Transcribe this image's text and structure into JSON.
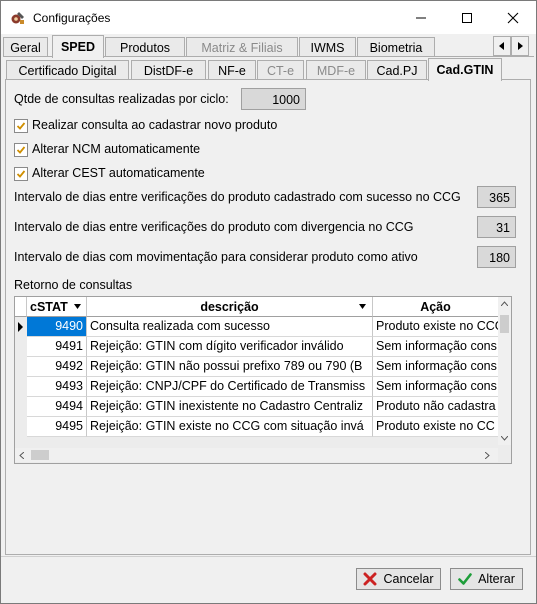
{
  "window": {
    "title": "Configurações"
  },
  "tabs_main": [
    {
      "label": "Geral",
      "state": "normal"
    },
    {
      "label": "SPED",
      "state": "active"
    },
    {
      "label": "Produtos",
      "state": "normal"
    },
    {
      "label": "Matriz & Filiais",
      "state": "disabled"
    },
    {
      "label": "IWMS",
      "state": "normal"
    },
    {
      "label": "Biometria",
      "state": "normal"
    }
  ],
  "tabs_sub": [
    {
      "label": "Certificado Digital",
      "state": "normal"
    },
    {
      "label": "DistDF-e",
      "state": "normal"
    },
    {
      "label": "NF-e",
      "state": "normal"
    },
    {
      "label": "CT-e",
      "state": "disabled"
    },
    {
      "label": "MDF-e",
      "state": "disabled"
    },
    {
      "label": "Cad.PJ",
      "state": "normal"
    },
    {
      "label": "Cad.GTIN",
      "state": "active"
    }
  ],
  "form": {
    "qtde_label": "Qtde de consultas realizadas por ciclo:",
    "qtde_value": "1000",
    "checkboxes": [
      {
        "label": "Realizar consulta ao cadastrar novo produto",
        "checked": true
      },
      {
        "label": "Alterar NCM automaticamente",
        "checked": true
      },
      {
        "label": "Alterar CEST automaticamente",
        "checked": true
      }
    ],
    "intervals": [
      {
        "label": "Intervalo de dias entre verificações do produto cadastrado com sucesso no CCG",
        "value": "365"
      },
      {
        "label": "Intervalo de dias entre verificações do produto com divergencia no CCG",
        "value": "31"
      },
      {
        "label": "Intervalo de dias com movimentação para considerar produto como ativo",
        "value": "180"
      }
    ],
    "grid_title": "Retorno de consultas"
  },
  "grid": {
    "columns": [
      "cSTAT",
      "descrição",
      "Ação"
    ],
    "rows": [
      {
        "cstat": "9490",
        "descricao": "Consulta realizada com sucesso",
        "acao": "Produto existe no CCG",
        "selected": true
      },
      {
        "cstat": "9491",
        "descricao": "Rejeição: GTIN com dígito verificador inválido",
        "acao": "Sem informação cons"
      },
      {
        "cstat": "9492",
        "descricao": "Rejeição: GTIN não possui prefixo 789 ou 790 (B",
        "acao": "Sem informação cons"
      },
      {
        "cstat": "9493",
        "descricao": "Rejeição: CNPJ/CPF do Certificado de Transmiss",
        "acao": "Sem informação cons"
      },
      {
        "cstat": "9494",
        "descricao": "Rejeição: GTIN inexistente no Cadastro Centraliz",
        "acao": "Produto não cadastra"
      },
      {
        "cstat": "9495",
        "descricao": "Rejeição: GTIN existe no CCG com situação invá",
        "acao": "Produto existe no CC"
      }
    ]
  },
  "buttons": {
    "cancel": "Cancelar",
    "ok": "Alterar"
  },
  "colors": {
    "selected_cell": "#0078d7",
    "check": "#d08f00",
    "cancel_x": "#cc2222",
    "ok_check": "#1e9e3a"
  }
}
